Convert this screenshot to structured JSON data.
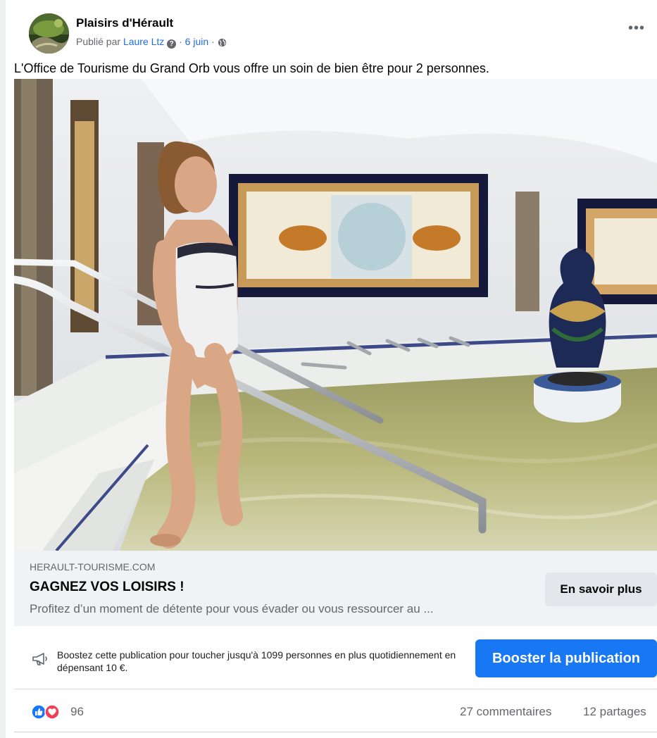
{
  "post": {
    "page_name": "Plaisirs d'Hérault",
    "published_by_prefix": "Publié par",
    "author": "Laure Ltz",
    "author_badge": "?",
    "separator": "·",
    "date": "6 juin",
    "more_label": "•••",
    "text": "L'Office de Tourisme du Grand Orb vous offre un soin de bien être pour 2 personnes."
  },
  "link_preview": {
    "domain": "HERAULT-TOURISME.COM",
    "title": "GAGNEZ VOS LOISIRS !",
    "description": "Profitez d’un moment de détente pour vous évader ou vous ressourcer au ...",
    "cta_label": "En savoir plus"
  },
  "boost": {
    "text": "Boostez cette publication pour toucher jusqu'à 1099 personnes en plus quotidiennement en dépensant 10 €.",
    "button_label": "Booster la publication"
  },
  "engagement": {
    "reaction_count": "96",
    "reaction_icons": [
      "like-icon",
      "love-icon"
    ],
    "comments": "27 commentaires",
    "shares": "12 partages"
  },
  "colors": {
    "accent": "#1877f2",
    "like": "#1877f2",
    "love": "#f33e58",
    "link": "#216fdb"
  }
}
